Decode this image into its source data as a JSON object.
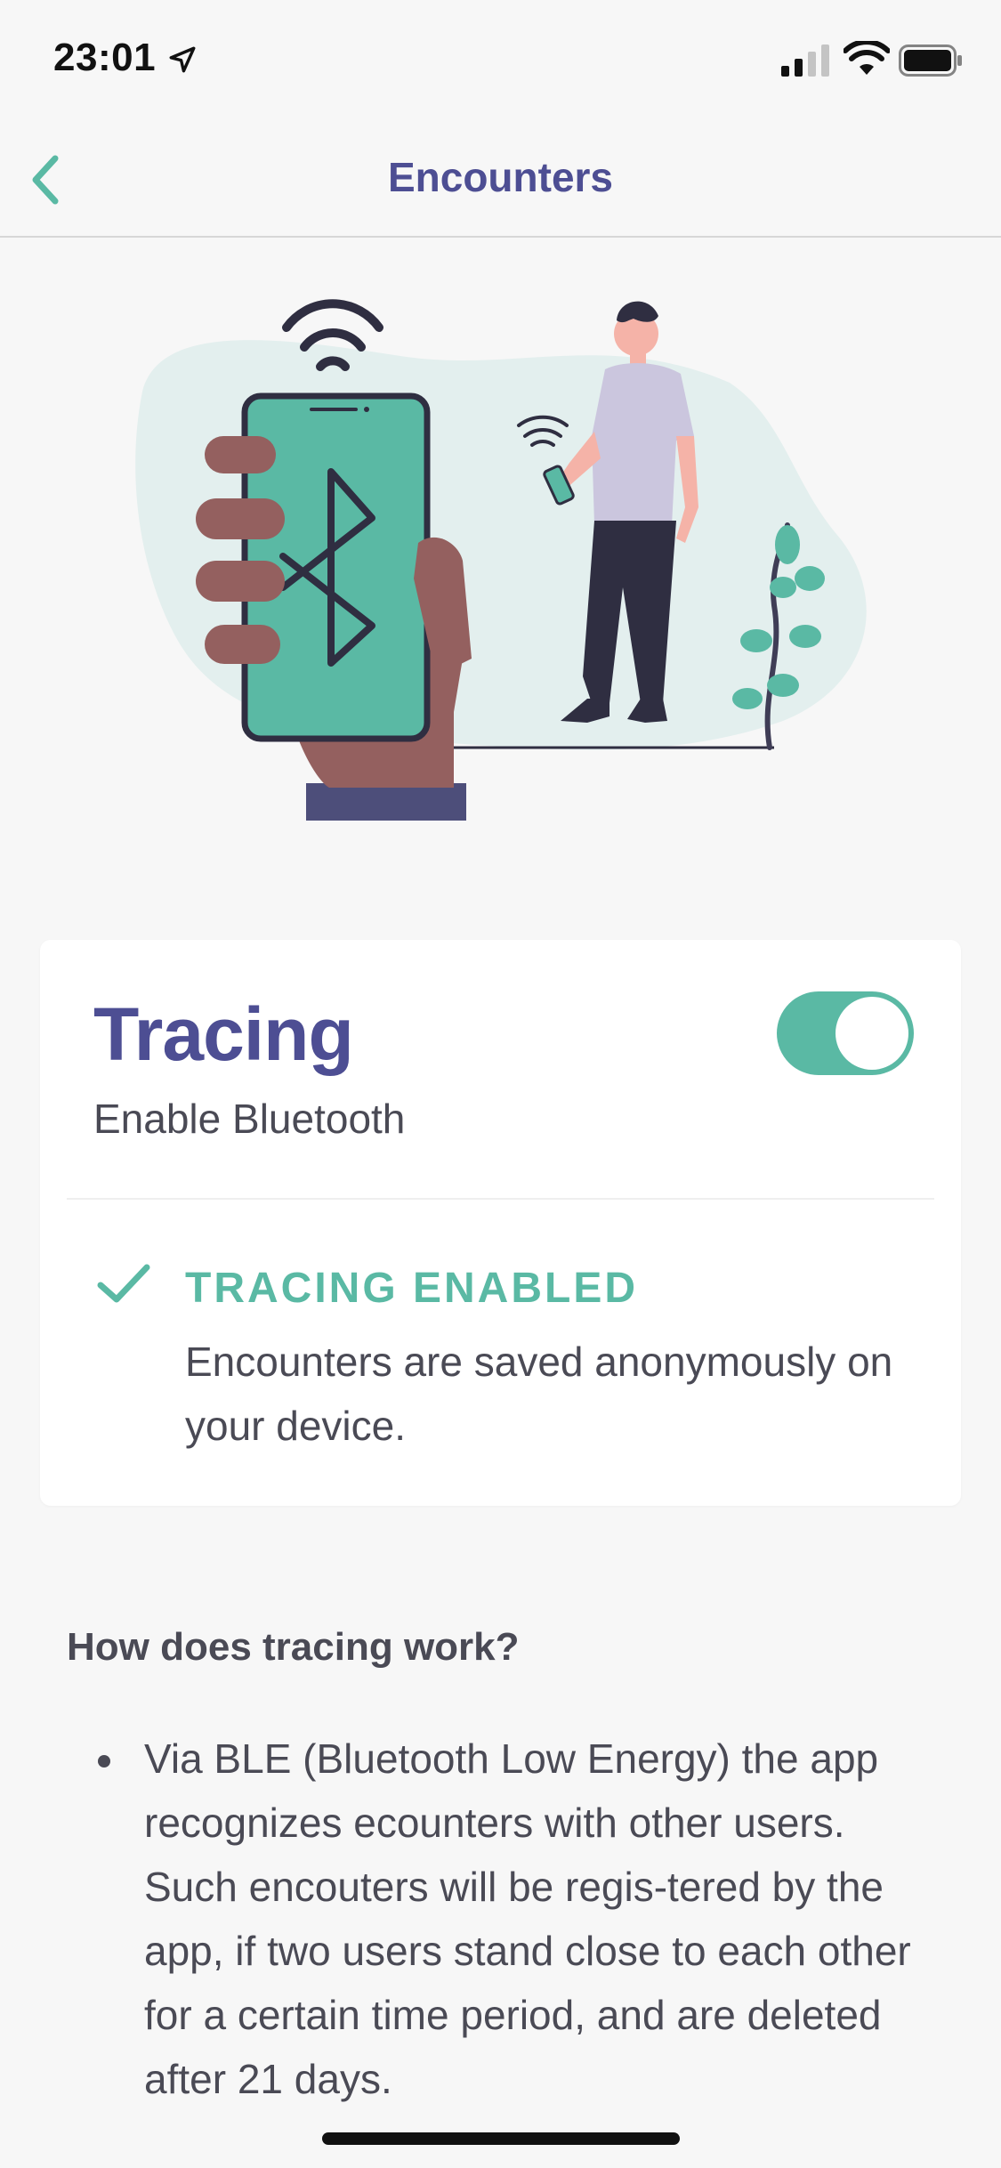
{
  "status_bar": {
    "time": "23:01"
  },
  "nav": {
    "title": "Encounters"
  },
  "card": {
    "title": "Tracing",
    "subtitle": "Enable Bluetooth",
    "toggle_on": true,
    "status_label": "TRACING ENABLED",
    "status_text": "Encounters are saved anonymously on your device."
  },
  "how": {
    "heading": "How does tracing work?",
    "bullets": [
      "Via BLE (Bluetooth Low Energy) the app recognizes ecounters with other users. Such encouters will be regis-tered by the app, if two users stand close to each other for a certain time period, and are deleted after 21 days."
    ]
  },
  "colors": {
    "accent": "#5ab9a4",
    "title": "#4d4e93",
    "text": "#4a4a55",
    "background": "#f7f7f7"
  },
  "icons": [
    "location-arrow-icon",
    "signal-icon",
    "wifi-icon",
    "battery-icon",
    "back-chevron-icon",
    "bluetooth-icon",
    "check-icon"
  ]
}
